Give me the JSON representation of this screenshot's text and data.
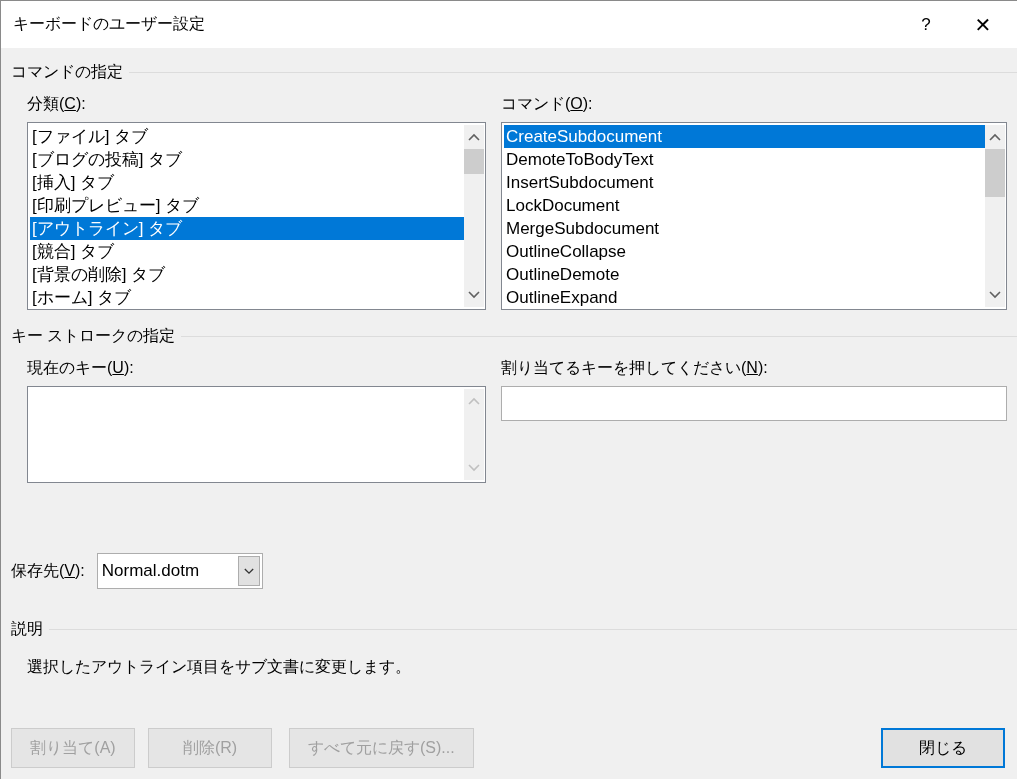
{
  "window": {
    "title": "キーボードのユーザー設定",
    "help": "?",
    "close": "✕"
  },
  "command_section": {
    "title": "コマンドの指定",
    "categories": {
      "label": {
        "before": "分類(",
        "key": "C",
        "after": "):"
      },
      "items": [
        {
          "text": "[ファイル] タブ",
          "selected": false
        },
        {
          "text": "[ブログの投稿] タブ",
          "selected": false
        },
        {
          "text": "[挿入] タブ",
          "selected": false
        },
        {
          "text": "[印刷プレビュー] タブ",
          "selected": false
        },
        {
          "text": "[アウトライン] タブ",
          "selected": true
        },
        {
          "text": "[競合] タブ",
          "selected": false
        },
        {
          "text": "[背景の削除] タブ",
          "selected": false
        },
        {
          "text": "[ホーム] タブ",
          "selected": false
        }
      ]
    },
    "commands": {
      "label": {
        "before": "コマンド(",
        "key": "O",
        "after": "):"
      },
      "items": [
        {
          "text": "CreateSubdocument",
          "selected": true
        },
        {
          "text": "DemoteToBodyText",
          "selected": false
        },
        {
          "text": "InsertSubdocument",
          "selected": false
        },
        {
          "text": "LockDocument",
          "selected": false
        },
        {
          "text": "MergeSubdocument",
          "selected": false
        },
        {
          "text": "OutlineCollapse",
          "selected": false
        },
        {
          "text": "OutlineDemote",
          "selected": false
        },
        {
          "text": "OutlineExpand",
          "selected": false
        }
      ]
    }
  },
  "keystroke_section": {
    "title": "キー ストロークの指定",
    "current_keys": {
      "label": {
        "before": "現在のキー(",
        "key": "U",
        "after": "):"
      }
    },
    "new_key": {
      "label": {
        "before": "割り当てるキーを押してください(",
        "key": "N",
        "after": "):"
      }
    }
  },
  "save_in": {
    "label": {
      "before": "保存先(",
      "key": "V",
      "after": "):"
    },
    "value": "Normal.dotm"
  },
  "description": {
    "title": "説明",
    "text": "選択したアウトライン項目をサブ文書に変更します。"
  },
  "buttons": [
    {
      "label": "割り当て(A)",
      "disabled": true,
      "default": false
    },
    {
      "label": "削除(R)",
      "disabled": true,
      "default": false
    },
    {
      "label": "すべて元に戻す(S)...",
      "disabled": true,
      "default": false
    }
  ],
  "close_button": {
    "label": "閉じる",
    "disabled": false,
    "default": true
  }
}
